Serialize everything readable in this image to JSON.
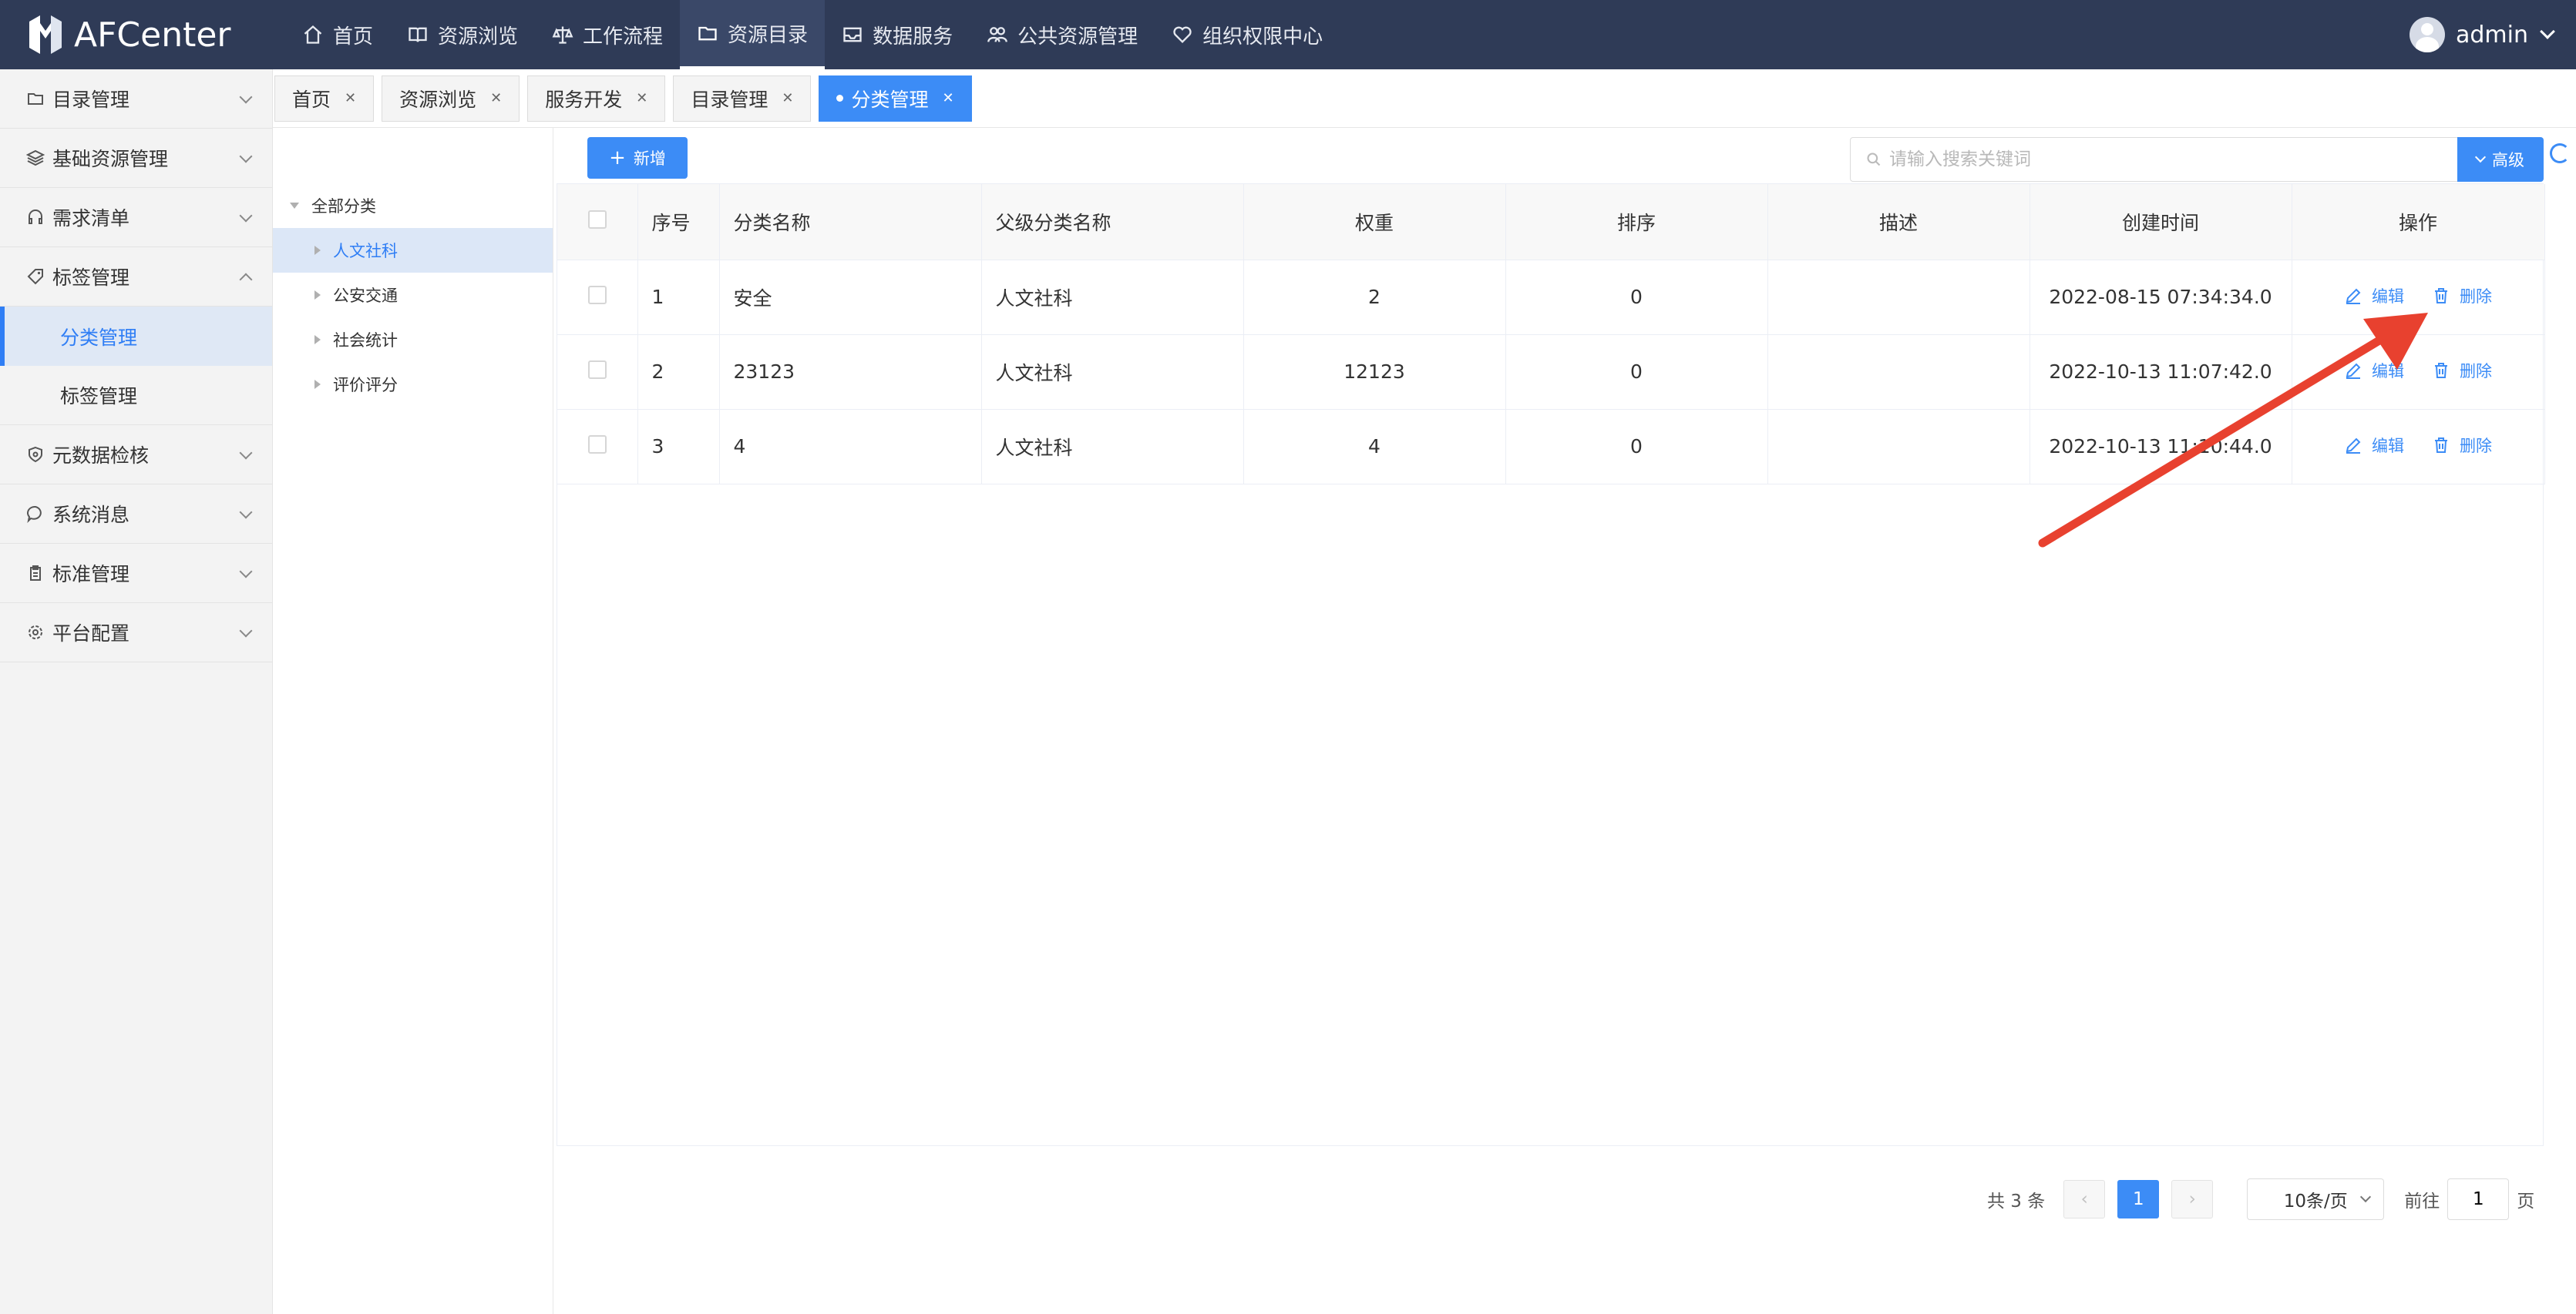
{
  "app": {
    "name": "AFCenter",
    "user": "admin"
  },
  "nav": [
    {
      "label": "首页",
      "icon": "home-icon",
      "active": false
    },
    {
      "label": "资源浏览",
      "icon": "book-icon",
      "active": false
    },
    {
      "label": "工作流程",
      "icon": "scale-icon",
      "active": false
    },
    {
      "label": "资源目录",
      "icon": "folder-icon",
      "active": true
    },
    {
      "label": "数据服务",
      "icon": "inbox-icon",
      "active": false
    },
    {
      "label": "公共资源管理",
      "icon": "people-icon",
      "active": false
    },
    {
      "label": "组织权限中心",
      "icon": "heart-icon",
      "active": false
    }
  ],
  "sidebar": {
    "items": [
      {
        "label": "目录管理",
        "icon": "folder-icon"
      },
      {
        "label": "基础资源管理",
        "icon": "layers-icon"
      },
      {
        "label": "需求清单",
        "icon": "headset-icon"
      },
      {
        "label": "标签管理",
        "icon": "tag-icon",
        "expanded": true
      },
      {
        "label": "分类管理",
        "sub": true,
        "active": true
      },
      {
        "label": "标签管理",
        "sub": true
      },
      {
        "label": "元数据检核",
        "icon": "shield-icon"
      },
      {
        "label": "系统消息",
        "icon": "chat-icon"
      },
      {
        "label": "标准管理",
        "icon": "clipboard-icon"
      },
      {
        "label": "平台配置",
        "icon": "gear-icon"
      }
    ]
  },
  "tabs": [
    {
      "label": "首页",
      "active": false
    },
    {
      "label": "资源浏览",
      "active": false
    },
    {
      "label": "服务开发",
      "active": false
    },
    {
      "label": "目录管理",
      "active": false
    },
    {
      "label": "分类管理",
      "active": true
    }
  ],
  "tree": {
    "root": "全部分类",
    "children": [
      {
        "label": "人文社科",
        "selected": true
      },
      {
        "label": "公安交通",
        "selected": false
      },
      {
        "label": "社会统计",
        "selected": false
      },
      {
        "label": "评价评分",
        "selected": false
      }
    ]
  },
  "toolbar": {
    "add_label": "新增",
    "search_placeholder": "请输入搜索关键词",
    "advanced_label": "高级"
  },
  "table": {
    "columns": [
      "序号",
      "分类名称",
      "父级分类名称",
      "权重",
      "排序",
      "描述",
      "创建时间",
      "操作"
    ],
    "rows": [
      {
        "index": "1",
        "name": "安全",
        "parent": "人文社科",
        "weight": "2",
        "order": "0",
        "desc": "",
        "created": "2022-08-15 07:34:34.0"
      },
      {
        "index": "2",
        "name": "23123",
        "parent": "人文社科",
        "weight": "12123",
        "order": "0",
        "desc": "",
        "created": "2022-10-13 11:07:42.0"
      },
      {
        "index": "3",
        "name": "4",
        "parent": "人文社科",
        "weight": "4",
        "order": "0",
        "desc": "",
        "created": "2022-10-13 11:10:44.0"
      }
    ],
    "edit_label": "编辑",
    "delete_label": "删除"
  },
  "pagination": {
    "total_text": "共 3 条",
    "current_page": "1",
    "page_size": "10条/页",
    "goto_label": "前往",
    "goto_value": "1",
    "page_suffix": "页"
  },
  "colors": {
    "topbar": "#2f3b57",
    "accent": "#3c8cf6",
    "annotation": "#e8412f"
  }
}
